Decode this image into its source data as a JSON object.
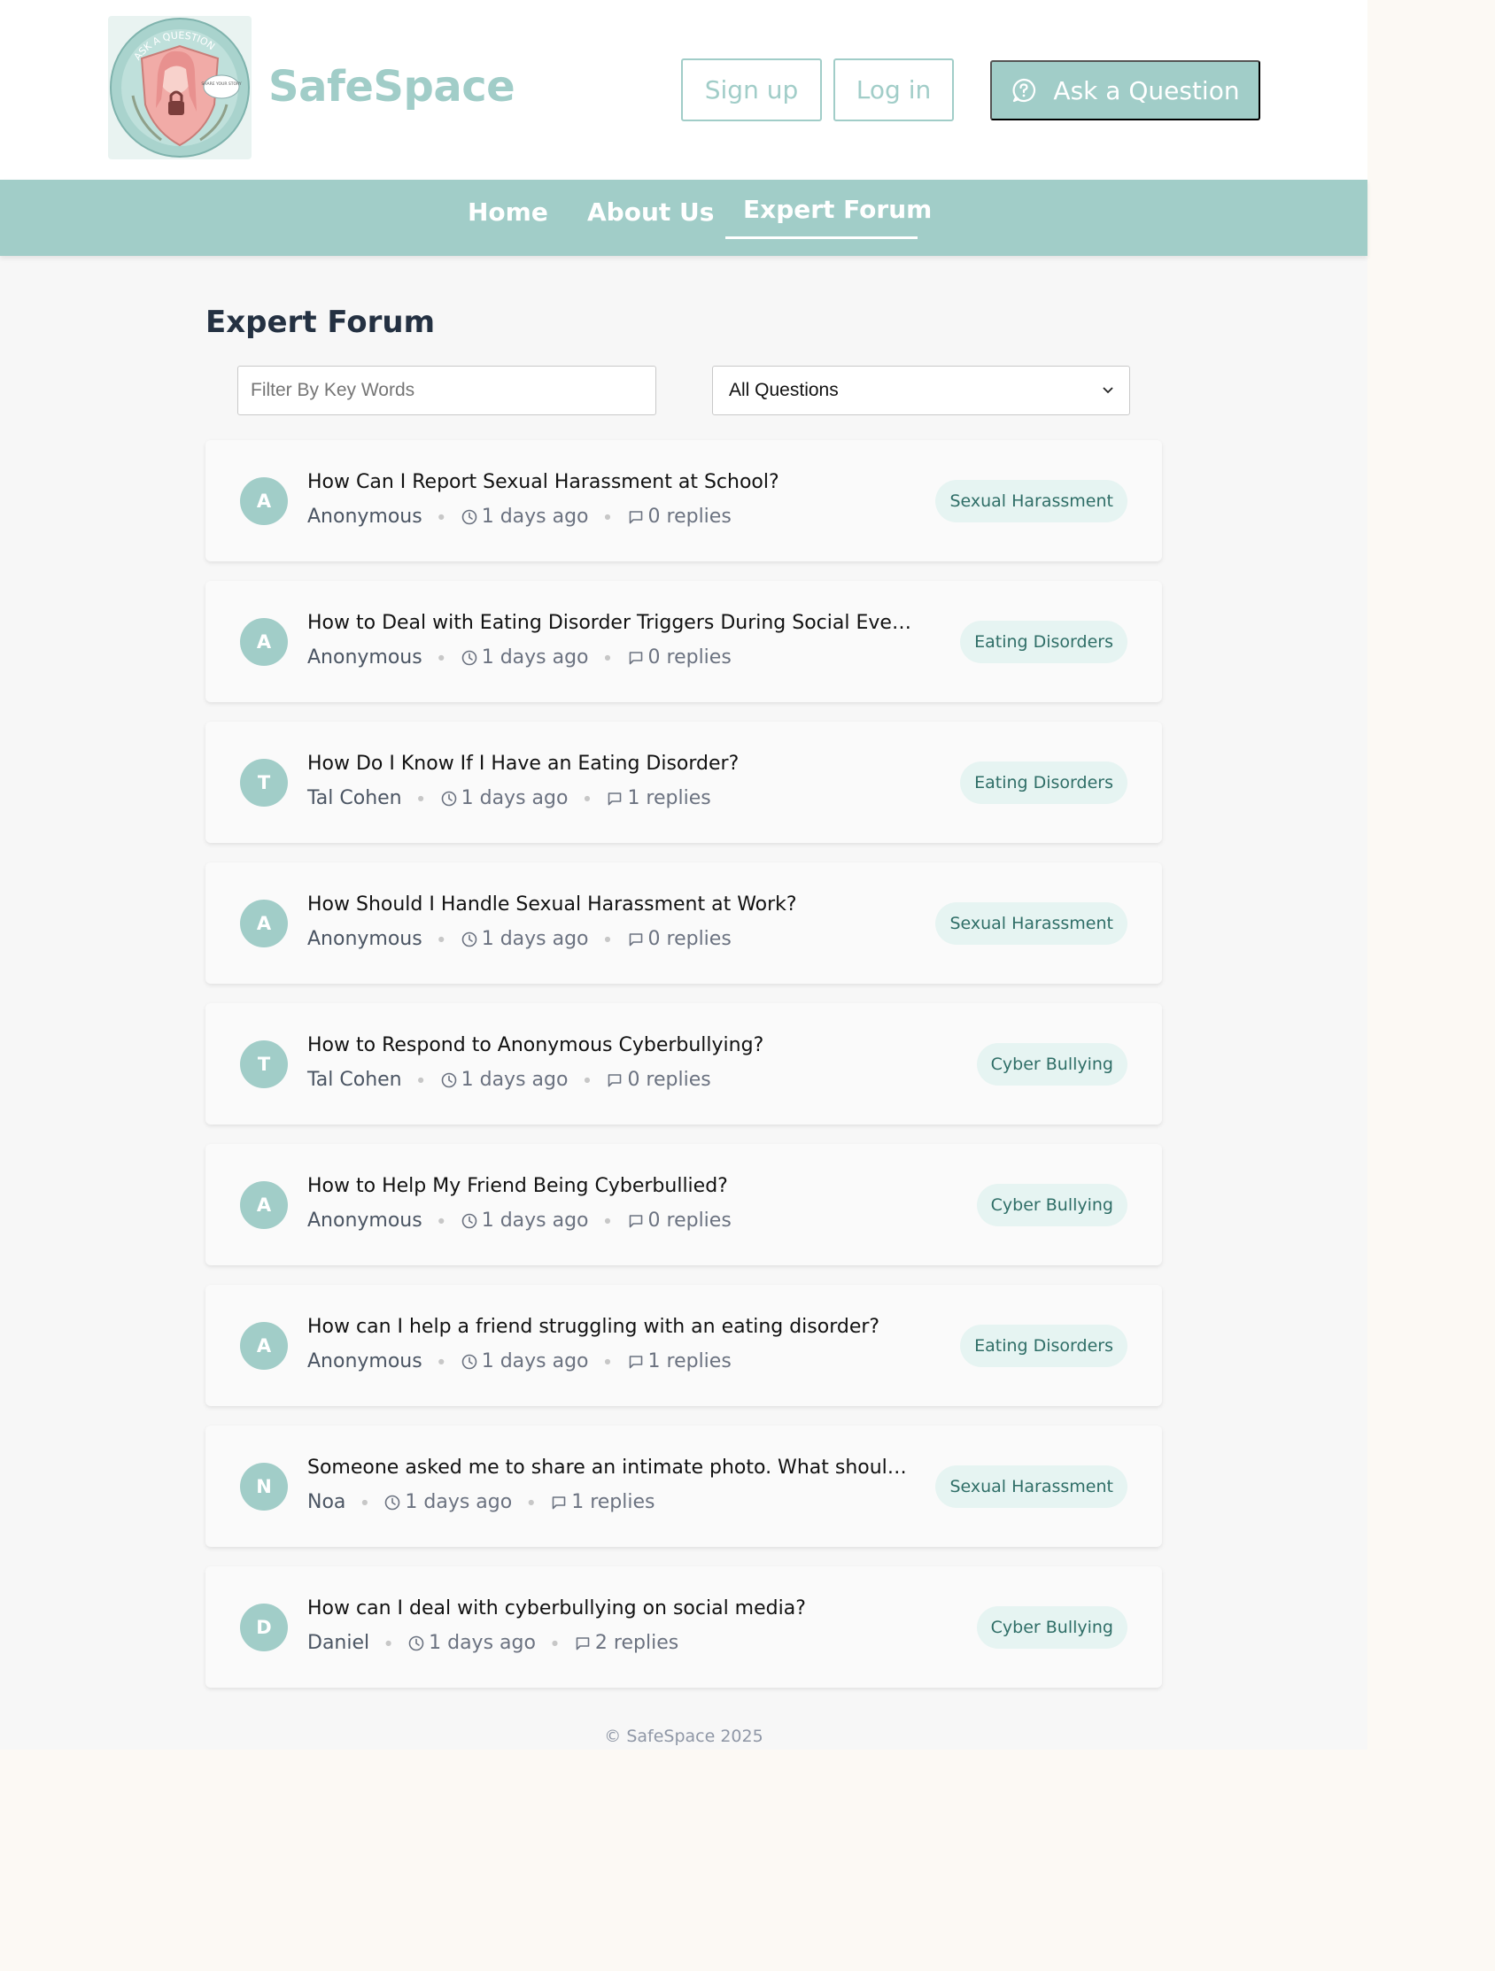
{
  "header": {
    "brand": "SafeSpace",
    "logo": {
      "arc_text": "ASK A QUESTION",
      "bubble_text": "SHARE YOUR STORY"
    },
    "signup_label": "Sign up",
    "login_label": "Log in",
    "ask_label": "Ask a Question",
    "ask_icon": "question-bubble-icon"
  },
  "nav": {
    "items": [
      {
        "label": "Home"
      },
      {
        "label": "About Us"
      },
      {
        "label": "Expert Forum",
        "active": true
      }
    ]
  },
  "main": {
    "title": "Expert Forum",
    "search_placeholder": "Filter By Key Words",
    "filter_value": "All Questions"
  },
  "questions": [
    {
      "initial": "A",
      "title": "How Can I Report Sexual Harassment at School?",
      "author": "Anonymous",
      "time": "1 days ago",
      "replies": "0 replies",
      "tag": "Sexual Harassment"
    },
    {
      "initial": "A",
      "title": "How to Deal with Eating Disorder Triggers During Social Events?",
      "author": "Anonymous",
      "time": "1 days ago",
      "replies": "0 replies",
      "tag": "Eating Disorders"
    },
    {
      "initial": "T",
      "title": "How Do I Know If I Have an Eating Disorder?",
      "author": "Tal Cohen",
      "time": "1 days ago",
      "replies": "1 replies",
      "tag": "Eating Disorders"
    },
    {
      "initial": "A",
      "title": "How Should I Handle Sexual Harassment at Work?",
      "author": "Anonymous",
      "time": "1 days ago",
      "replies": "0 replies",
      "tag": "Sexual Harassment"
    },
    {
      "initial": "T",
      "title": "How to Respond to Anonymous Cyberbullying?",
      "author": "Tal Cohen",
      "time": "1 days ago",
      "replies": "0 replies",
      "tag": "Cyber Bullying"
    },
    {
      "initial": "A",
      "title": "How to Help My Friend Being Cyberbullied?",
      "author": "Anonymous",
      "time": "1 days ago",
      "replies": "0 replies",
      "tag": "Cyber Bullying"
    },
    {
      "initial": "A",
      "title": "How can I help a friend struggling with an eating disorder?",
      "author": "Anonymous",
      "time": "1 days ago",
      "replies": "1 replies",
      "tag": "Eating Disorders"
    },
    {
      "initial": "N",
      "title": "Someone asked me to share an intimate photo. What should ...",
      "author": "Noa",
      "time": "1 days ago",
      "replies": "1 replies",
      "tag": "Sexual Harassment"
    },
    {
      "initial": "D",
      "title": "How can I deal with cyberbullying on social media?",
      "author": "Daniel",
      "time": "1 days ago",
      "replies": "2 replies",
      "tag": "Cyber Bullying"
    }
  ],
  "footer": {
    "text": "© SafeSpace 2025"
  },
  "colors": {
    "accent": "#a1cdc8",
    "tag_bg": "#e6f4f2",
    "tag_text": "#2f6e67",
    "title_dark": "#243142",
    "page_bg": "#f7f7f7"
  }
}
